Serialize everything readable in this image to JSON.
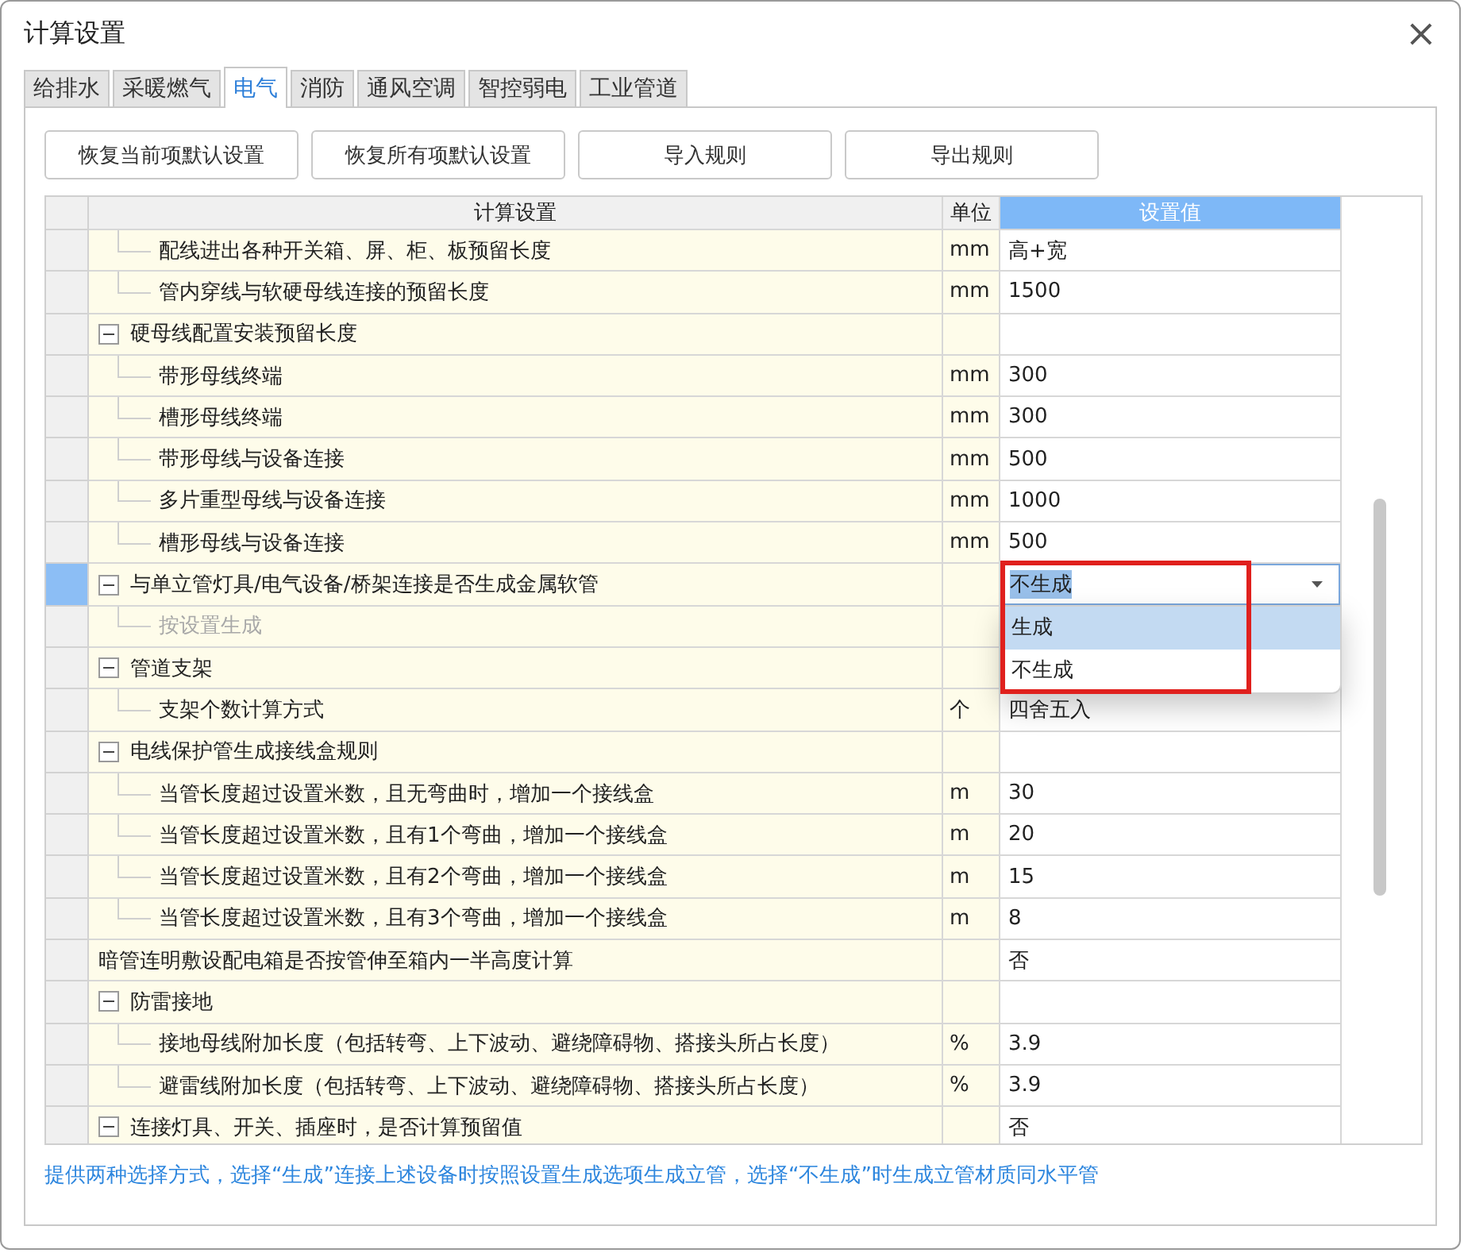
{
  "window": {
    "title": "计算设置",
    "close": "×"
  },
  "tabs": [
    {
      "label": "给排水",
      "selected": false
    },
    {
      "label": "采暖燃气",
      "selected": false
    },
    {
      "label": "电气",
      "selected": true
    },
    {
      "label": "消防",
      "selected": false
    },
    {
      "label": "通风空调",
      "selected": false
    },
    {
      "label": "智控弱电",
      "selected": false
    },
    {
      "label": "工业管道",
      "selected": false
    }
  ],
  "buttons": [
    "恢复当前项默认设置",
    "恢复所有项默认设置",
    "导入规则",
    "导出规则"
  ],
  "table": {
    "columns": [
      "计算设置",
      "单位",
      "设置值"
    ],
    "rows": [
      {
        "children": [
          {
            "name": "配线进出各种开关箱、屏、柜、板预留长度",
            "unit": "mm",
            "value": "高+宽",
            "selected": false,
            "disabled": false
          },
          {
            "name": "管内穿线与软硬母线连接的预留长度",
            "unit": "mm",
            "value": "1500",
            "selected": false,
            "disabled": false
          }
        ]
      },
      {
        "name": "硬母线配置安装预留长度",
        "expanded": true,
        "selected": false,
        "children": [
          {
            "name": "带形母线终端",
            "unit": "mm",
            "value": "300",
            "selected": false,
            "disabled": false
          },
          {
            "name": "槽形母线终端",
            "unit": "mm",
            "value": "300",
            "selected": false,
            "disabled": false
          },
          {
            "name": "带形母线与设备连接",
            "unit": "mm",
            "value": "500",
            "selected": false,
            "disabled": false
          },
          {
            "name": "多片重型母线与设备连接",
            "unit": "mm",
            "value": "1000",
            "selected": false,
            "disabled": false
          },
          {
            "name": "槽形母线与设备连接",
            "unit": "mm",
            "value": "500",
            "selected": false,
            "disabled": false
          }
        ]
      },
      {
        "name": "与单立管灯具/电气设备/桥架连接是否生成金属软管",
        "expanded": true,
        "selected": true,
        "dropdown": {
          "value": "不生成",
          "options": [
            {
              "label": "生成",
              "highlighted": true
            },
            {
              "label": "不生成",
              "highlighted": false
            }
          ]
        },
        "children": [
          {
            "name": "按设置生成",
            "selected": false,
            "disabled": true
          }
        ]
      },
      {
        "name": "管道支架",
        "expanded": true,
        "selected": false,
        "children": [
          {
            "name": "支架个数计算方式",
            "unit": "个",
            "value": "四舍五入",
            "selected": false,
            "disabled": false
          }
        ]
      },
      {
        "name": "电线保护管生成接线盒规则",
        "expanded": true,
        "selected": false,
        "children": [
          {
            "name": "当管长度超过设置米数，且无弯曲时，增加一个接线盒",
            "unit": "m",
            "value": "30",
            "selected": false,
            "disabled": false
          },
          {
            "name": "当管长度超过设置米数，且有1个弯曲，增加一个接线盒",
            "unit": "m",
            "value": "20",
            "selected": false,
            "disabled": false
          },
          {
            "name": "当管长度超过设置米数，且有2个弯曲，增加一个接线盒",
            "unit": "m",
            "value": "15",
            "selected": false,
            "disabled": false
          },
          {
            "name": "当管长度超过设置米数，且有3个弯曲，增加一个接线盒",
            "unit": "m",
            "value": "8",
            "selected": false,
            "disabled": false
          }
        ]
      },
      {
        "name": "暗管连明敷设配电箱是否按管伸至箱内一半高度计算",
        "value": "否",
        "selected": false,
        "disabled": false
      },
      {
        "name": "防雷接地",
        "expanded": true,
        "selected": false,
        "children": [
          {
            "name": "接地母线附加长度（包括转弯、上下波动、避绕障碍物、搭接头所占长度）",
            "unit": "%",
            "value": "3.9",
            "selected": false,
            "disabled": false
          },
          {
            "name": "避雷线附加长度（包括转弯、上下波动、避绕障碍物、搭接头所占长度）",
            "unit": "%",
            "value": "3.9",
            "selected": false,
            "disabled": false
          }
        ]
      },
      {
        "name": "连接灯具、开关、插座时，是否计算预留值",
        "value": "否",
        "expanded": true,
        "selected": false
      }
    ]
  },
  "note": "提供两种选择方式，选择“生成”连接上述设备时按照设置生成选项生成立管，选择“不生成”时生成立管材质同水平管"
}
